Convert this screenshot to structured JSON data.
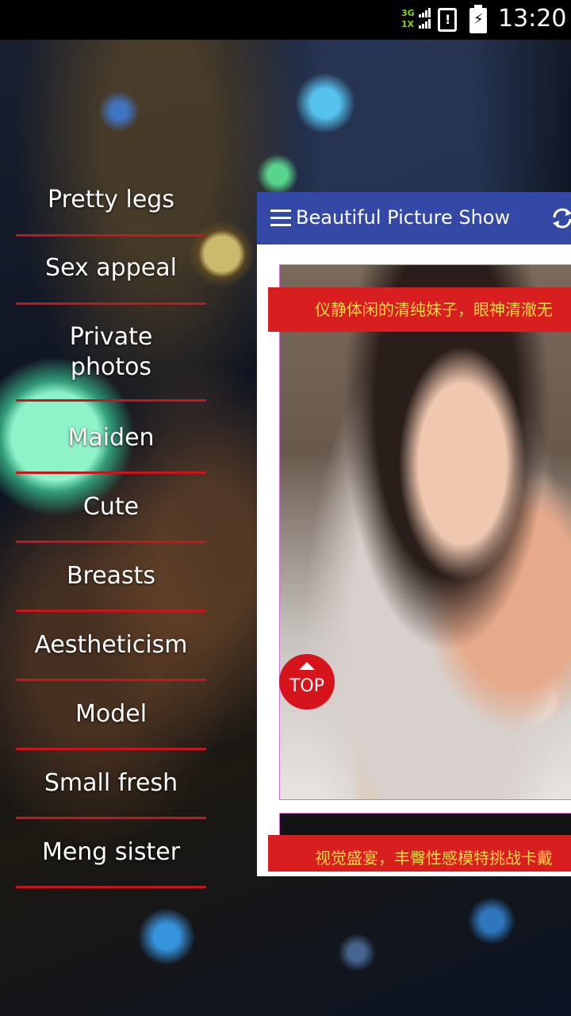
{
  "status_bar": {
    "network_top": "3G",
    "network_bottom": "1X",
    "sim_alert": "!",
    "battery_symbol": "⚡",
    "time": "13:20",
    "icons": [
      "signal-icon",
      "sim-alert-icon",
      "battery-charging-icon"
    ]
  },
  "drawer": {
    "items": [
      {
        "label": "Pretty legs"
      },
      {
        "label": "Sex appeal"
      },
      {
        "label": "Private photos"
      },
      {
        "label": "Maiden"
      },
      {
        "label": "Cute"
      },
      {
        "label": "Breasts"
      },
      {
        "label": "Aestheticism"
      },
      {
        "label": "Model"
      },
      {
        "label": "Small fresh"
      },
      {
        "label": "Meng sister"
      }
    ],
    "divider_color": "#c8141c"
  },
  "toolbar": {
    "title": "Beautiful Picture Show",
    "menu_icon": "hamburger-icon",
    "refresh_icon": "refresh-icon",
    "color": "#3448a6"
  },
  "feed": {
    "items": [
      {
        "caption": "仪静体闲的清纯妹子，眼神清澈无"
      },
      {
        "caption": "视觉盛宴，丰臀性感模特挑战卡戴"
      }
    ],
    "banner_color": "#d81e1e",
    "caption_color": "#ffd84a"
  },
  "top_button": {
    "label": "TOP",
    "icon": "arrow-up-icon",
    "color": "#d6141c"
  }
}
